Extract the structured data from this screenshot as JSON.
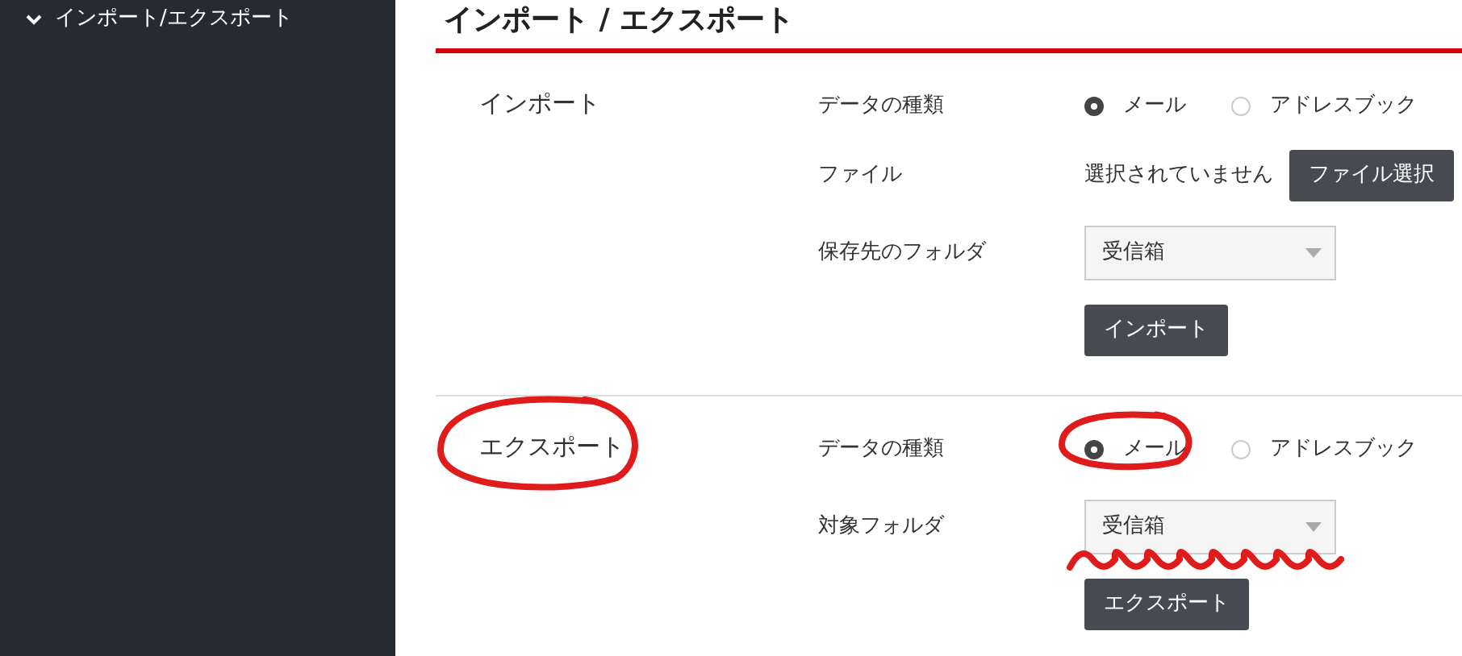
{
  "sidebar": {
    "items": [
      {
        "label": "インポート/エクスポート",
        "expanded": true
      }
    ]
  },
  "page_title": "インポート / エクスポート",
  "sections": [
    {
      "title": "インポート",
      "circled": false,
      "fields": [
        {
          "kind": "radio",
          "label": "データの種類",
          "options": [
            {
              "label": "メール",
              "selected": true,
              "circled": false
            },
            {
              "label": "アドレスブック",
              "selected": false,
              "circled": false
            }
          ]
        },
        {
          "kind": "file",
          "label": "ファイル",
          "status": "選択されていません",
          "button": "ファイル選択"
        },
        {
          "kind": "select",
          "label": "保存先のフォルダ",
          "value": "受信箱",
          "underlined": false
        }
      ],
      "submit": "インポート"
    },
    {
      "title": "エクスポート",
      "circled": true,
      "fields": [
        {
          "kind": "radio",
          "label": "データの種類",
          "options": [
            {
              "label": "メール",
              "selected": true,
              "circled": true
            },
            {
              "label": "アドレスブック",
              "selected": false,
              "circled": false
            }
          ]
        },
        {
          "kind": "select",
          "label": "対象フォルダ",
          "value": "受信箱",
          "underlined": true
        }
      ],
      "submit": "エクスポート"
    }
  ]
}
